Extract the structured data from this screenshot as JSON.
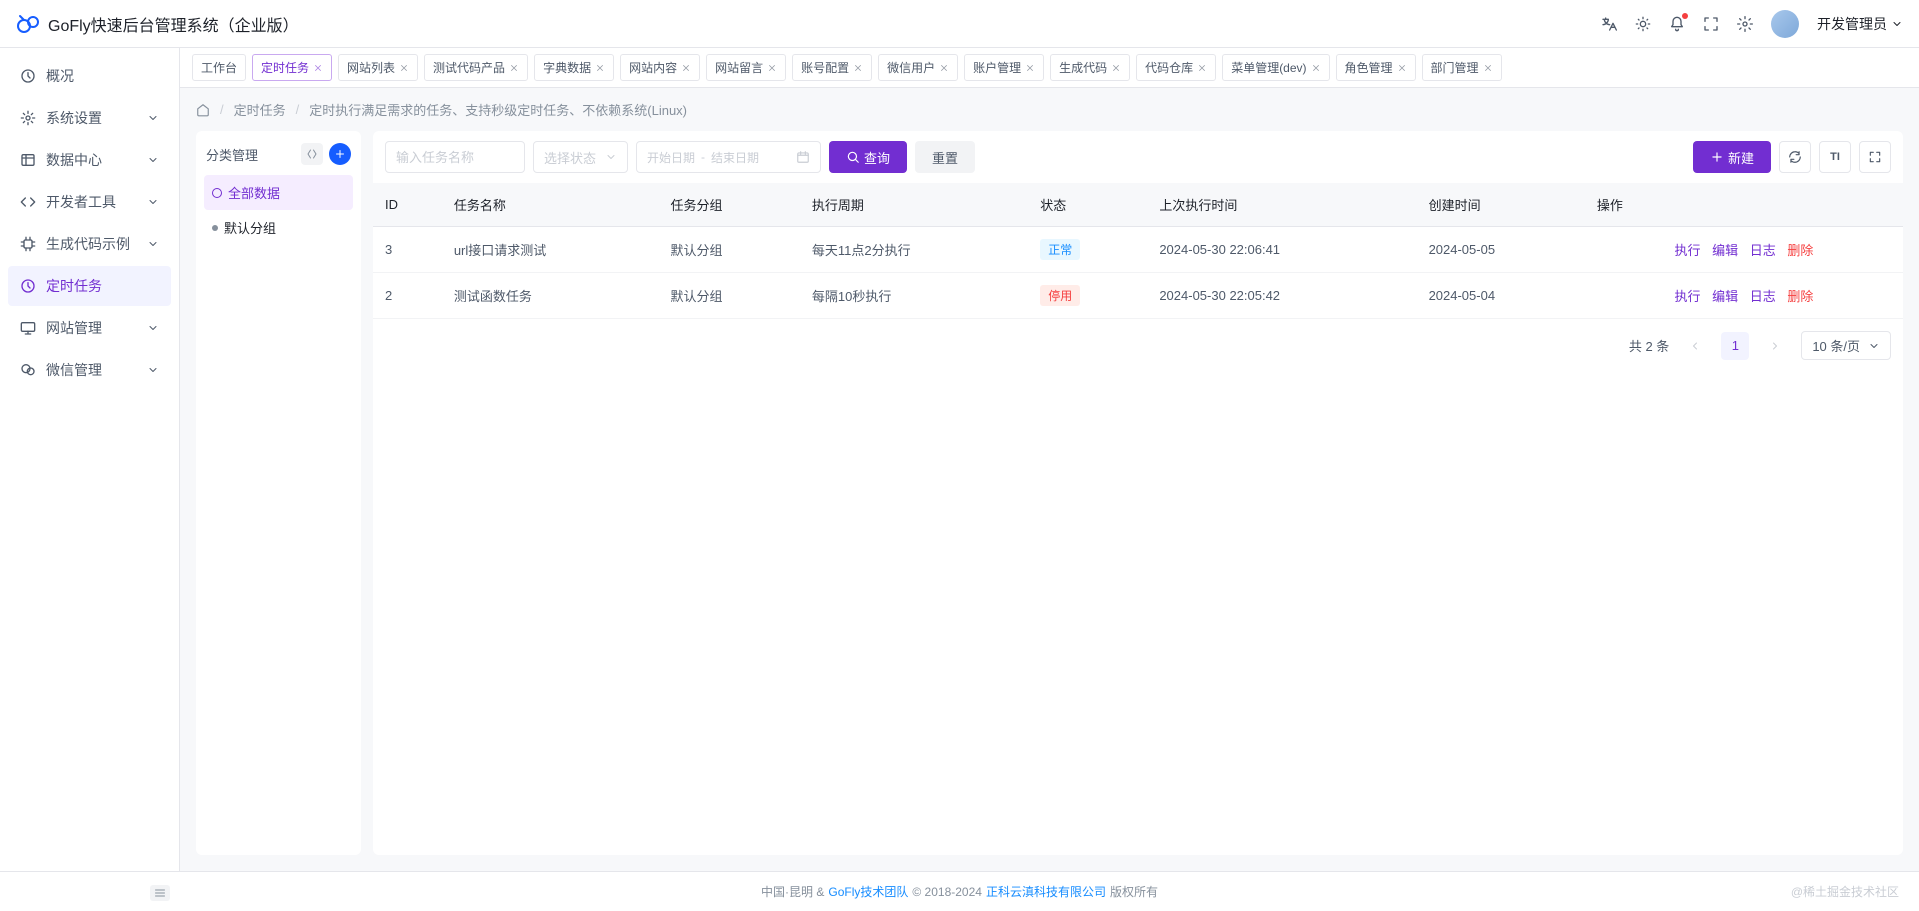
{
  "app": {
    "title": "GoFly快速后台管理系统（企业版）"
  },
  "user": {
    "name": "开发管理员"
  },
  "sidebar": [
    {
      "label": "概况",
      "icon": "dashboard"
    },
    {
      "label": "系统设置",
      "icon": "gear",
      "expandable": true
    },
    {
      "label": "数据中心",
      "icon": "list",
      "expandable": true
    },
    {
      "label": "开发者工具",
      "icon": "code",
      "expandable": true
    },
    {
      "label": "生成代码示例",
      "icon": "chip",
      "expandable": true
    },
    {
      "label": "定时任务",
      "icon": "clock",
      "active": true
    },
    {
      "label": "网站管理",
      "icon": "monitor",
      "expandable": true
    },
    {
      "label": "微信管理",
      "icon": "wechat",
      "expandable": true
    }
  ],
  "tabs": [
    {
      "label": "工作台",
      "closable": false
    },
    {
      "label": "定时任务",
      "active": true,
      "closable": true
    },
    {
      "label": "网站列表",
      "closable": true
    },
    {
      "label": "测试代码产品",
      "closable": true
    },
    {
      "label": "字典数据",
      "closable": true
    },
    {
      "label": "网站内容",
      "closable": true
    },
    {
      "label": "网站留言",
      "closable": true
    },
    {
      "label": "账号配置",
      "closable": true
    },
    {
      "label": "微信用户",
      "closable": true
    },
    {
      "label": "账户管理",
      "closable": true
    },
    {
      "label": "生成代码",
      "closable": true
    },
    {
      "label": "代码仓库",
      "closable": true
    },
    {
      "label": "菜单管理(dev)",
      "closable": true
    },
    {
      "label": "角色管理",
      "closable": true
    },
    {
      "label": "部门管理",
      "closable": true
    }
  ],
  "breadcrumb": {
    "current": "定时任务",
    "desc": "定时执行满足需求的任务、支持秒级定时任务、不依赖系统(Linux)"
  },
  "category": {
    "title": "分类管理",
    "items": [
      {
        "label": "全部数据",
        "active": true
      },
      {
        "label": "默认分组"
      }
    ]
  },
  "toolbar": {
    "name_placeholder": "输入任务名称",
    "status_placeholder": "选择状态",
    "date_start": "开始日期",
    "date_sep": "-",
    "date_end": "结束日期",
    "search": "查询",
    "reset": "重置",
    "new": "新建"
  },
  "table": {
    "columns": [
      "ID",
      "任务名称",
      "任务分组",
      "执行周期",
      "状态",
      "上次执行时间",
      "创建时间",
      "操作"
    ],
    "rows": [
      {
        "id": "3",
        "name": "url接口请求测试",
        "group": "默认分组",
        "cycle": "每天11点2分执行",
        "status": "正常",
        "status_type": "normal",
        "last_exec": "2024-05-30 22:06:41",
        "created": "2024-05-05"
      },
      {
        "id": "2",
        "name": "测试函数任务",
        "group": "默认分组",
        "cycle": "每隔10秒执行",
        "status": "停用",
        "status_type": "stop",
        "last_exec": "2024-05-30 22:05:42",
        "created": "2024-05-04"
      }
    ],
    "actions": {
      "exec": "执行",
      "edit": "编辑",
      "log": "日志",
      "delete": "删除"
    }
  },
  "pagination": {
    "total_text": "共 2 条",
    "current": "1",
    "size": "10 条/页"
  },
  "footer": {
    "loc": "中国·昆明 & ",
    "team": "GoFly技术团队",
    "copy": " © 2018-2024 ",
    "company": "正科云滇科技有限公司",
    "rights": " 版权所有",
    "watermark": "@稀土掘金技术社区"
  }
}
